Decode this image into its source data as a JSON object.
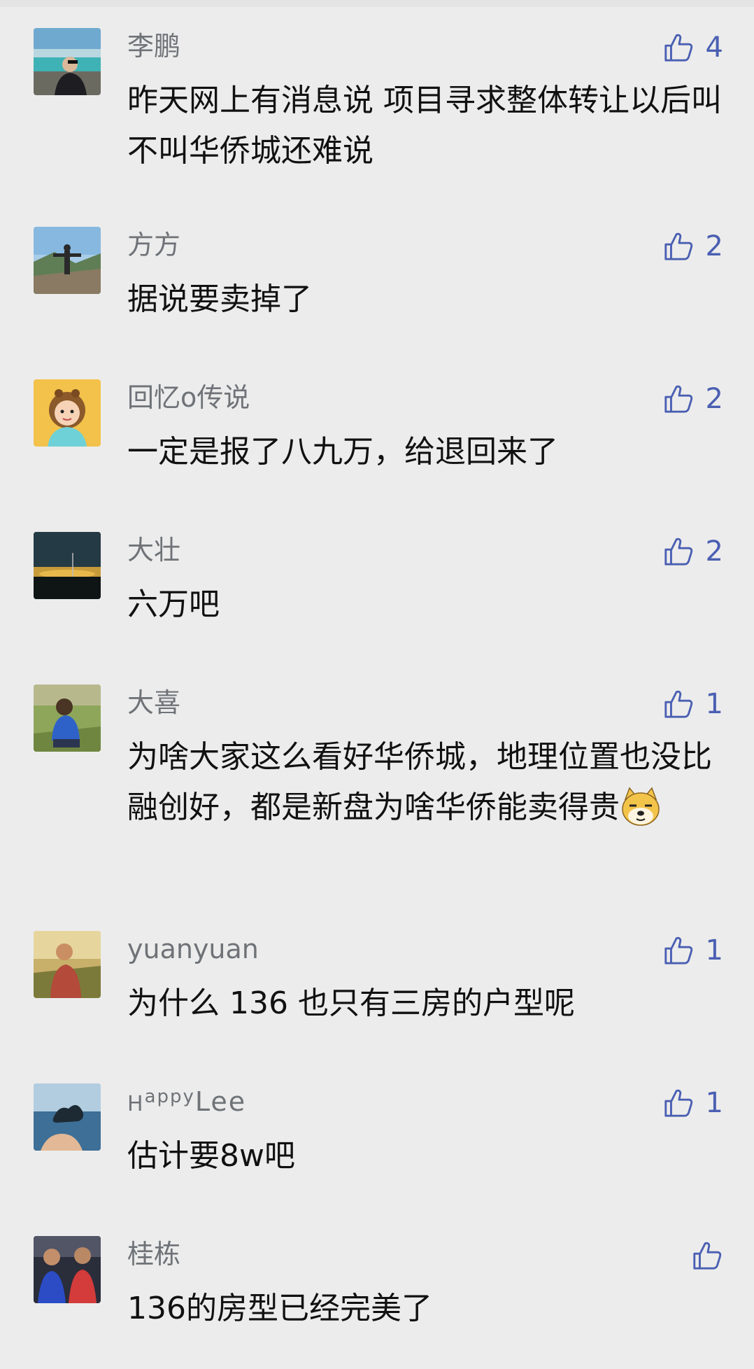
{
  "comments": [
    {
      "name": "李鹏",
      "text": "昨天网上有消息说 项目寻求整体转让以后叫不叫华侨城还难说",
      "likes": "4",
      "avatar": "person-by-sea-avatar"
    },
    {
      "name": "方方",
      "text": "据说要卖掉了",
      "likes": "2",
      "avatar": "person-mountain-avatar"
    },
    {
      "name": "回忆o传说",
      "text": "一定是报了八九万，给退回来了",
      "likes": "2",
      "avatar": "child-avatar"
    },
    {
      "name": "大壮",
      "text": "六万吧",
      "likes": "2",
      "avatar": "sunset-avatar"
    },
    {
      "name": "大喜",
      "text": "为啥大家这么看好华侨城，地理位置也没比融创好，都是新盘为啥华侨能卖得贵",
      "likes": "1",
      "avatar": "child-in-grass-avatar",
      "emoji": "doge-emoji"
    },
    {
      "name": "yuanyuan",
      "text": "为什么 136 也只有三房的户型呢",
      "likes": "1",
      "avatar": "woman-in-field-avatar"
    },
    {
      "name": "HappyLee",
      "text": "估计要8w吧",
      "likes": "1",
      "avatar": "hand-sea-avatar"
    },
    {
      "name": "桂栋",
      "text": "136的房型已经完美了",
      "likes": "",
      "avatar": "kids-avatar"
    }
  ],
  "icons": {
    "like": "thumbs-up-icon"
  },
  "colors": {
    "background": "#ececec",
    "name": "#6f7378",
    "like_icon": "#4a5fb2"
  }
}
